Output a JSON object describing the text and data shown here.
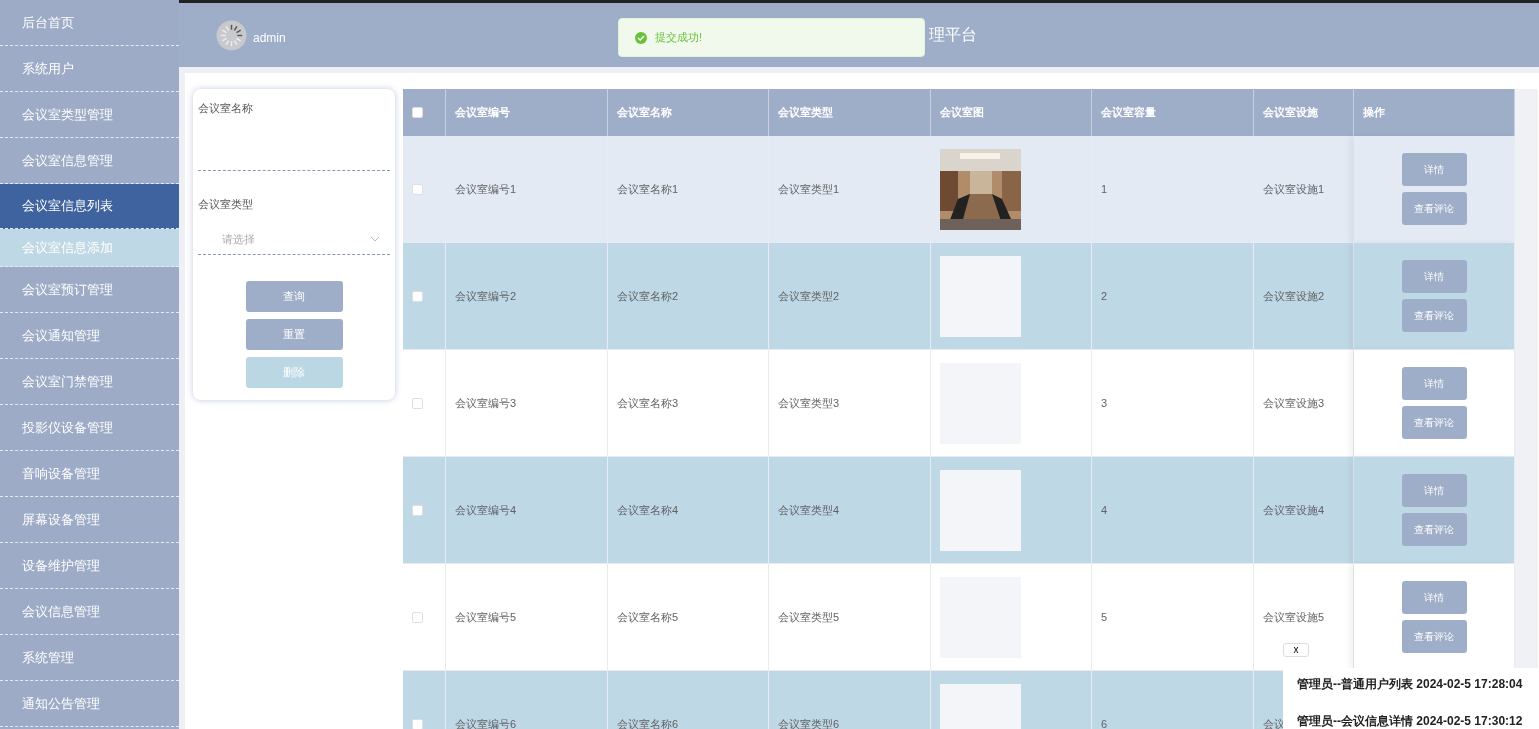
{
  "sidebar": {
    "items": [
      {
        "label": "后台首页",
        "selected": false
      },
      {
        "label": "系统用户",
        "selected": false
      },
      {
        "label": "会议室类型管理",
        "selected": false
      },
      {
        "label": "会议室信息管理",
        "selected": false,
        "expanded": true,
        "children": [
          {
            "label": "会议室信息列表",
            "selected": true
          },
          {
            "label": "会议室信息添加",
            "selected": false
          }
        ]
      },
      {
        "label": "会议室预订管理",
        "selected": false
      },
      {
        "label": "会议通知管理",
        "selected": false
      },
      {
        "label": "会议室门禁管理",
        "selected": false
      },
      {
        "label": "投影仪设备管理",
        "selected": false
      },
      {
        "label": "音响设备管理",
        "selected": false
      },
      {
        "label": "屏幕设备管理",
        "selected": false
      },
      {
        "label": "设备维护管理",
        "selected": false
      },
      {
        "label": "会议信息管理",
        "selected": false
      },
      {
        "label": "系统管理",
        "selected": false
      },
      {
        "label": "通知公告管理",
        "selected": false
      }
    ]
  },
  "header": {
    "user": "admin",
    "title": "理平台"
  },
  "toast": {
    "message": "提交成功!"
  },
  "search": {
    "fields": [
      {
        "label": "会议室名称",
        "kind": "text"
      },
      {
        "label": "会议室类型",
        "kind": "select",
        "placeholder": "请选择"
      }
    ],
    "buttons": [
      {
        "label": "查询",
        "disabled": false
      },
      {
        "label": "重置",
        "disabled": false
      },
      {
        "label": "删除",
        "disabled": true
      }
    ]
  },
  "table": {
    "header_checked": false,
    "columns": [
      "会议室编号",
      "会议室名称",
      "会议室类型",
      "会议室图",
      "会议室容量",
      "会议室设施",
      "操作"
    ],
    "rows": [
      {
        "checked": false,
        "hovered": true,
        "id": "会议室编号1",
        "name": "会议室名称1",
        "type": "会议室类型1",
        "image_loaded": true,
        "capacity": "1",
        "facility": "会议室设施1",
        "actions": [
          "详情",
          "查看评论"
        ]
      },
      {
        "checked": false,
        "hovered": false,
        "id": "会议室编号2",
        "name": "会议室名称2",
        "type": "会议室类型2",
        "image_loaded": false,
        "capacity": "2",
        "facility": "会议室设施2",
        "actions": [
          "详情",
          "查看评论"
        ]
      },
      {
        "checked": false,
        "hovered": false,
        "id": "会议室编号3",
        "name": "会议室名称3",
        "type": "会议室类型3",
        "image_loaded": false,
        "capacity": "3",
        "facility": "会议室设施3",
        "actions": [
          "详情",
          "查看评论"
        ]
      },
      {
        "checked": false,
        "hovered": false,
        "id": "会议室编号4",
        "name": "会议室名称4",
        "type": "会议室类型4",
        "image_loaded": false,
        "capacity": "4",
        "facility": "会议室设施4",
        "actions": [
          "详情",
          "查看评论"
        ]
      },
      {
        "checked": false,
        "hovered": false,
        "id": "会议室编号5",
        "name": "会议室名称5",
        "type": "会议室类型5",
        "image_loaded": false,
        "capacity": "5",
        "facility": "会议室设施5",
        "actions": [
          "详情",
          "查看评论"
        ]
      },
      {
        "checked": false,
        "hovered": false,
        "id": "会议室编号6",
        "name": "会议室名称6",
        "type": "会议室类型6",
        "image_loaded": false,
        "capacity": "6",
        "facility": "会议"
      }
    ]
  },
  "log_popup": {
    "close": "x",
    "entries": [
      "管理员--普通用户列表 2024-02-5 17:28:04",
      "管理员--会议信息详情 2024-02-5 17:30:12"
    ]
  }
}
